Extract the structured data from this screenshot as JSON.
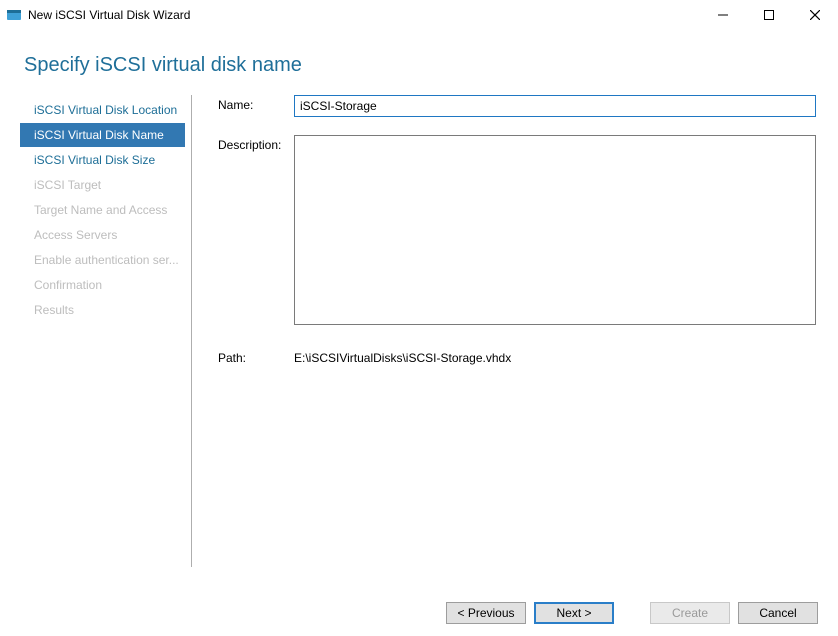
{
  "titlebar": {
    "title": "New iSCSI Virtual Disk Wizard"
  },
  "heading": "Specify iSCSI virtual disk name",
  "steps": [
    {
      "label": "iSCSI Virtual Disk Location",
      "state": "enabled"
    },
    {
      "label": "iSCSI Virtual Disk Name",
      "state": "selected"
    },
    {
      "label": "iSCSI Virtual Disk Size",
      "state": "enabled"
    },
    {
      "label": "iSCSI Target",
      "state": "disabled"
    },
    {
      "label": "Target Name and Access",
      "state": "disabled"
    },
    {
      "label": "Access Servers",
      "state": "disabled"
    },
    {
      "label": "Enable authentication ser...",
      "state": "disabled"
    },
    {
      "label": "Confirmation",
      "state": "disabled"
    },
    {
      "label": "Results",
      "state": "disabled"
    }
  ],
  "form": {
    "name_label": "Name:",
    "name_value": "iSCSI-Storage",
    "description_label": "Description:",
    "description_value": "",
    "path_label": "Path:",
    "path_value": "E:\\iSCSIVirtualDisks\\iSCSI-Storage.vhdx"
  },
  "buttons": {
    "previous": "< Previous",
    "next": "Next >",
    "create": "Create",
    "cancel": "Cancel"
  }
}
